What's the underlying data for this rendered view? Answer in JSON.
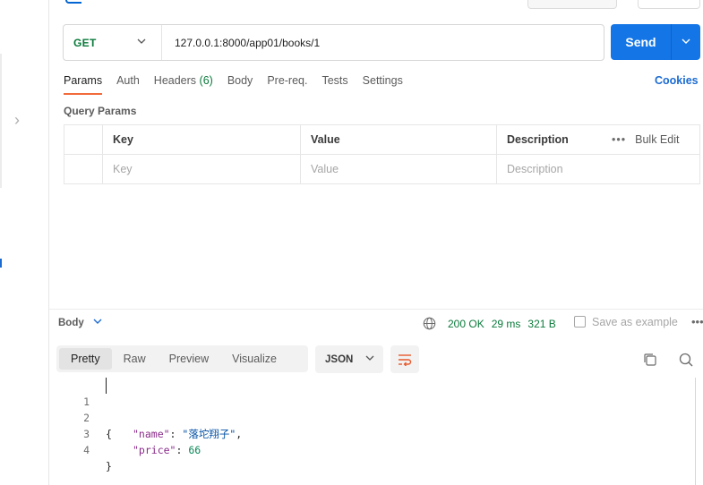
{
  "request": {
    "method": "GET",
    "url": "127.0.0.1:8000/app01/books/1",
    "send_label": "Send"
  },
  "tabs": [
    {
      "label": "Params",
      "count": ""
    },
    {
      "label": "Auth",
      "count": ""
    },
    {
      "label": "Headers",
      "count": "(6)"
    },
    {
      "label": "Body",
      "count": ""
    },
    {
      "label": "Pre-req.",
      "count": ""
    },
    {
      "label": "Tests",
      "count": ""
    },
    {
      "label": "Settings",
      "count": ""
    }
  ],
  "cookies_label": "Cookies",
  "query_params": {
    "title": "Query Params",
    "headers": {
      "key": "Key",
      "value": "Value",
      "description": "Description"
    },
    "bulk_edit": "Bulk Edit",
    "placeholders": {
      "key": "Key",
      "value": "Value",
      "description": "Description"
    }
  },
  "response": {
    "section_label": "Body",
    "status": "200 OK",
    "time": "29 ms",
    "size": "321 B",
    "save_label": "Save as example",
    "views": [
      "Pretty",
      "Raw",
      "Preview",
      "Visualize"
    ],
    "format": "JSON",
    "lines": [
      "1",
      "2",
      "3",
      "4"
    ],
    "json": {
      "open": "{",
      "name_key": "\"name\"",
      "name_value": "\"落坨翔子\"",
      "price_key": "\"price\"",
      "price_value": "66",
      "close": "}"
    }
  }
}
